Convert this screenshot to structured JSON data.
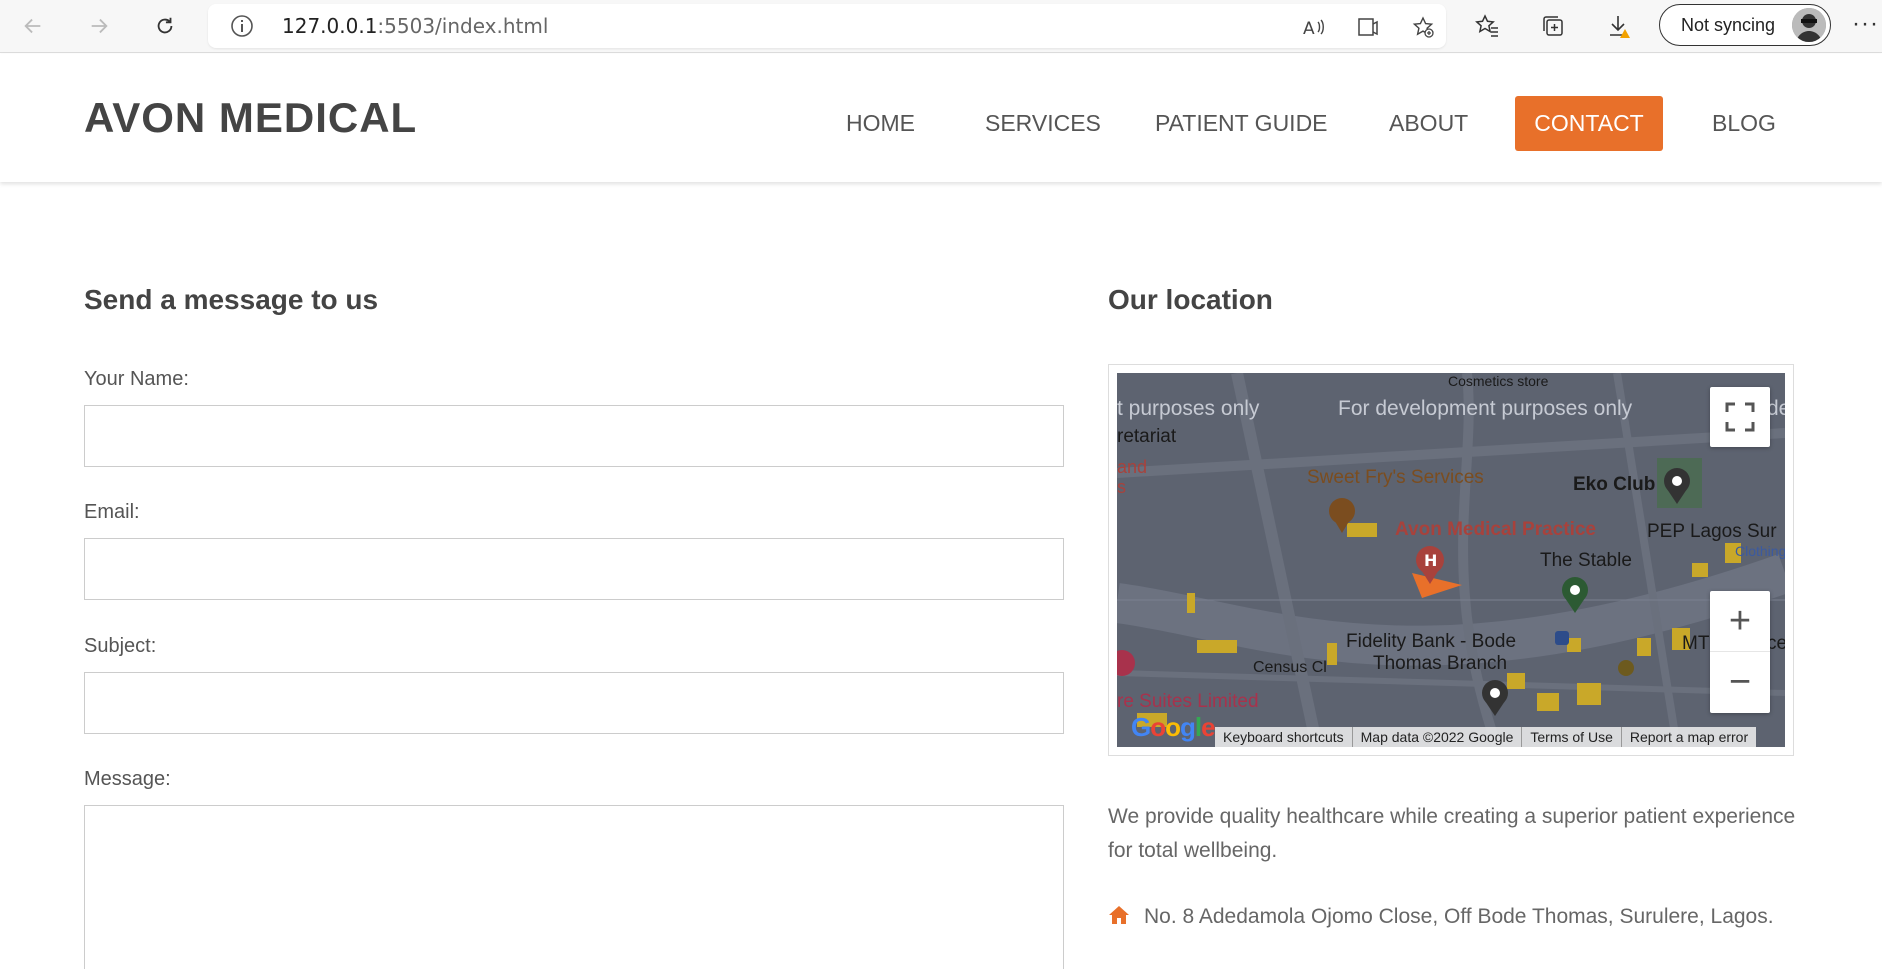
{
  "browser": {
    "url_host": "127.0.0.1",
    "url_rest": ":5503/index.html",
    "profile_label": "Not syncing",
    "more_label": "···"
  },
  "site": {
    "brand": "AVON MEDICAL",
    "nav": [
      {
        "label": "HOME"
      },
      {
        "label": "SERVICES"
      },
      {
        "label": "PATIENT GUIDE"
      },
      {
        "label": "ABOUT"
      },
      {
        "label": "CONTACT",
        "active": true
      },
      {
        "label": "BLOG"
      }
    ],
    "accent_color": "#e8702a"
  },
  "form": {
    "title": "Send a message to us",
    "name_label": "Your Name:",
    "email_label": "Email:",
    "subject_label": "Subject:",
    "message_label": "Message:",
    "name_value": "",
    "email_value": "",
    "subject_value": "",
    "message_value": ""
  },
  "location": {
    "title": "Our location",
    "map": {
      "watermark_left": "t purposes only",
      "watermark_center": "For development purposes only",
      "watermark_right": "de",
      "labels": {
        "cosmetics": "Cosmetics store",
        "secretariat": "retariat",
        "and": "and",
        "s": "s",
        "sweet_fry": "Sweet Fry's Services",
        "eko_club": "Eko Club",
        "avon_practice": "Avon Medical Practice",
        "pep": "PEP Lagos Sur",
        "clothing": "Clothing",
        "stable": "The Stable",
        "fidelity_1": "Fidelity Bank - Bode",
        "fidelity_2": "Thomas Branch",
        "census": "Census Cl",
        "suites": "re Suites Limited",
        "mt": "MT",
        "ce": "ce"
      },
      "google_logo": "Google",
      "footer": [
        "Keyboard shortcuts",
        "Map data ©2022 Google",
        "Terms of Use",
        "Report a map error"
      ],
      "zoom_in": "+",
      "zoom_out": "−"
    },
    "about": "We provide quality healthcare while creating a superior patient experience for total wellbeing.",
    "address": "No. 8 Adedamola Ojomo Close, Off Bode Thomas, Surulere, Lagos."
  }
}
